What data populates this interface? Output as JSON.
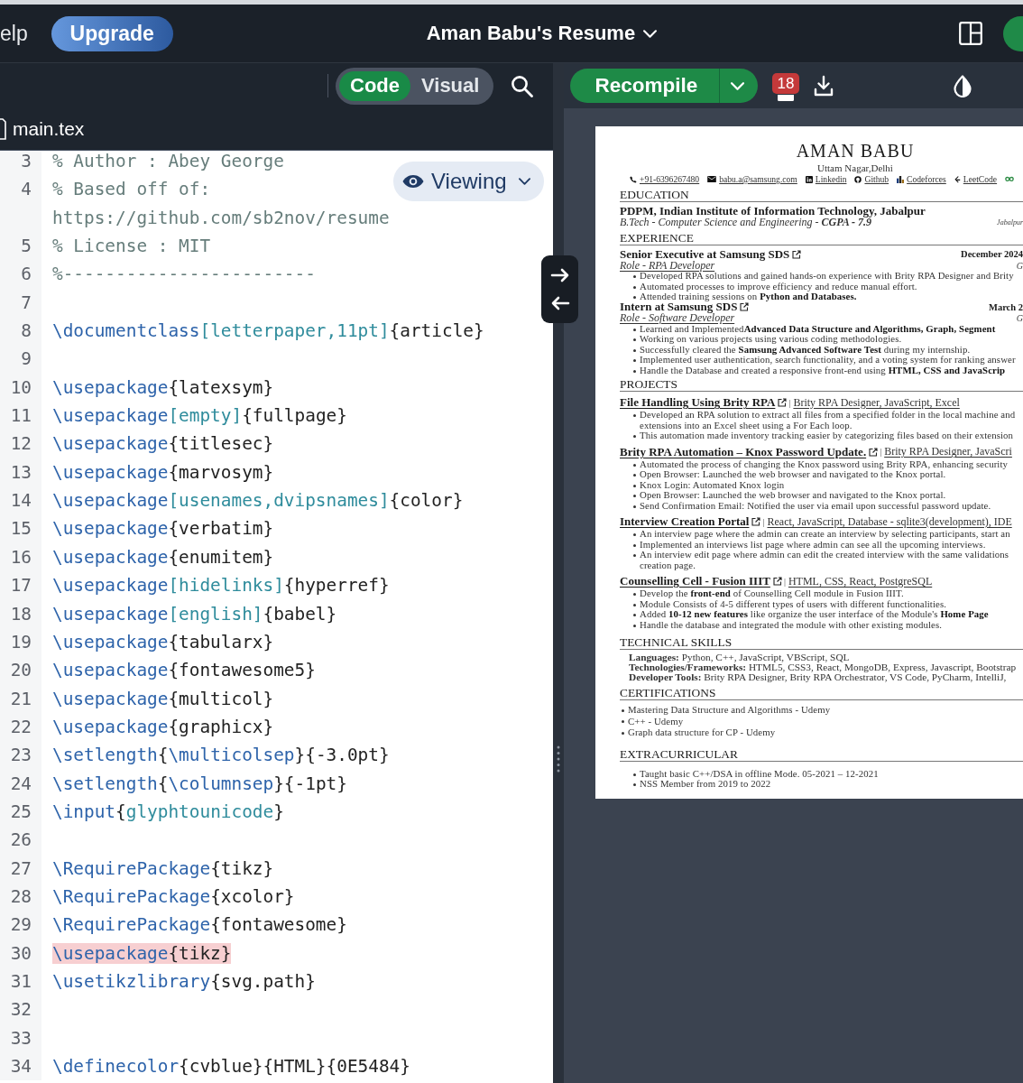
{
  "top_bar": {
    "help_menu": "elp",
    "upgrade_button": "Upgrade",
    "project_title": "Aman Babu's Resume"
  },
  "editor_toolbar": {
    "modes": [
      {
        "label": "Code",
        "selected": true
      },
      {
        "label": "Visual",
        "selected": false
      }
    ]
  },
  "file_tab": {
    "name": "main.tex"
  },
  "editor": {
    "view_mode": "Viewing",
    "lines": [
      {
        "number": "3",
        "highlighted": false,
        "tokens": [
          {
            "kind": "comment",
            "text": "% Author : Abey George"
          }
        ]
      },
      {
        "number": "4",
        "highlighted": false,
        "tokens": [
          {
            "kind": "comment",
            "text": "% Based off of: https://github.com/sb2nov/resume"
          }
        ]
      },
      {
        "number": "5",
        "highlighted": false,
        "tokens": [
          {
            "kind": "comment",
            "text": "% License : MIT"
          }
        ]
      },
      {
        "number": "6",
        "highlighted": false,
        "tokens": [
          {
            "kind": "comment",
            "text": "%------------------------"
          }
        ]
      },
      {
        "number": "7",
        "highlighted": false
      },
      {
        "number": "8",
        "highlighted": false,
        "tokens": [
          {
            "kind": "command",
            "text": "\\documentclass"
          },
          {
            "kind": "option",
            "text": "[letterpaper,11pt]"
          },
          {
            "kind": "text",
            "text": "{article}"
          }
        ]
      },
      {
        "number": "9",
        "highlighted": false
      },
      {
        "number": "10",
        "highlighted": false,
        "tokens": [
          {
            "kind": "command",
            "text": "\\usepackage"
          },
          {
            "kind": "text",
            "text": "{latexsym}"
          }
        ]
      },
      {
        "number": "11",
        "highlighted": false,
        "tokens": [
          {
            "kind": "command",
            "text": "\\usepackage"
          },
          {
            "kind": "option",
            "text": "[empty]"
          },
          {
            "kind": "text",
            "text": "{fullpage}"
          }
        ]
      },
      {
        "number": "12",
        "highlighted": false,
        "tokens": [
          {
            "kind": "command",
            "text": "\\usepackage"
          },
          {
            "kind": "text",
            "text": "{titlesec}"
          }
        ]
      },
      {
        "number": "13",
        "highlighted": false,
        "tokens": [
          {
            "kind": "command",
            "text": "\\usepackage"
          },
          {
            "kind": "text",
            "text": "{marvosym}"
          }
        ]
      },
      {
        "number": "14",
        "highlighted": false,
        "tokens": [
          {
            "kind": "command",
            "text": "\\usepackage"
          },
          {
            "kind": "option",
            "text": "[usenames,dvipsnames]"
          },
          {
            "kind": "text",
            "text": "{color}"
          }
        ]
      },
      {
        "number": "15",
        "highlighted": false,
        "tokens": [
          {
            "kind": "command",
            "text": "\\usepackage"
          },
          {
            "kind": "text",
            "text": "{verbatim}"
          }
        ]
      },
      {
        "number": "16",
        "highlighted": false,
        "tokens": [
          {
            "kind": "command",
            "text": "\\usepackage"
          },
          {
            "kind": "text",
            "text": "{enumitem}"
          }
        ]
      },
      {
        "number": "17",
        "highlighted": false,
        "tokens": [
          {
            "kind": "command",
            "text": "\\usepackage"
          },
          {
            "kind": "option",
            "text": "[hidelinks]"
          },
          {
            "kind": "text",
            "text": "{hyperref}"
          }
        ]
      },
      {
        "number": "18",
        "highlighted": false,
        "tokens": [
          {
            "kind": "command",
            "text": "\\usepackage"
          },
          {
            "kind": "option",
            "text": "[english]"
          },
          {
            "kind": "text",
            "text": "{babel}"
          }
        ]
      },
      {
        "number": "19",
        "highlighted": false,
        "tokens": [
          {
            "kind": "command",
            "text": "\\usepackage"
          },
          {
            "kind": "text",
            "text": "{tabularx}"
          }
        ]
      },
      {
        "number": "20",
        "highlighted": false,
        "tokens": [
          {
            "kind": "command",
            "text": "\\usepackage"
          },
          {
            "kind": "text",
            "text": "{fontawesome5}"
          }
        ]
      },
      {
        "number": "21",
        "highlighted": false,
        "tokens": [
          {
            "kind": "command",
            "text": "\\usepackage"
          },
          {
            "kind": "text",
            "text": "{multicol}"
          }
        ]
      },
      {
        "number": "22",
        "highlighted": false,
        "tokens": [
          {
            "kind": "command",
            "text": "\\usepackage"
          },
          {
            "kind": "text",
            "text": "{graphicx}"
          }
        ]
      },
      {
        "number": "23",
        "highlighted": false,
        "tokens": [
          {
            "kind": "command",
            "text": "\\setlength"
          },
          {
            "kind": "text",
            "text": "{"
          },
          {
            "kind": "command",
            "text": "\\multicolsep"
          },
          {
            "kind": "text",
            "text": "}{-3.0pt}"
          }
        ]
      },
      {
        "number": "24",
        "highlighted": false,
        "tokens": [
          {
            "kind": "command",
            "text": "\\setlength"
          },
          {
            "kind": "text",
            "text": "{"
          },
          {
            "kind": "command",
            "text": "\\columnsep"
          },
          {
            "kind": "text",
            "text": "}{-1pt}"
          }
        ]
      },
      {
        "number": "25",
        "highlighted": false,
        "tokens": [
          {
            "kind": "command",
            "text": "\\input"
          },
          {
            "kind": "text",
            "text": "{"
          },
          {
            "kind": "option",
            "text": "glyphtounicode"
          },
          {
            "kind": "text",
            "text": "}"
          }
        ]
      },
      {
        "number": "26",
        "highlighted": false
      },
      {
        "number": "27",
        "highlighted": false,
        "tokens": [
          {
            "kind": "command",
            "text": "\\RequirePackage"
          },
          {
            "kind": "text",
            "text": "{tikz}"
          }
        ]
      },
      {
        "number": "28",
        "highlighted": false,
        "tokens": [
          {
            "kind": "command",
            "text": "\\RequirePackage"
          },
          {
            "kind": "text",
            "text": "{xcolor}"
          }
        ]
      },
      {
        "number": "29",
        "highlighted": false,
        "tokens": [
          {
            "kind": "command",
            "text": "\\RequirePackage"
          },
          {
            "kind": "text",
            "text": "{fontawesome}"
          }
        ]
      },
      {
        "number": "30",
        "highlighted": true,
        "tokens": [
          {
            "kind": "command",
            "text": "\\usepackage"
          },
          {
            "kind": "text",
            "text": "{tikz}"
          }
        ]
      },
      {
        "number": "31",
        "highlighted": false,
        "tokens": [
          {
            "kind": "command",
            "text": "\\usetikzlibrary"
          },
          {
            "kind": "text",
            "text": "{svg.path}"
          }
        ]
      },
      {
        "number": "32",
        "highlighted": false
      },
      {
        "number": "33",
        "highlighted": false
      },
      {
        "number": "34",
        "highlighted": false,
        "tokens": [
          {
            "kind": "command",
            "text": "\\definecolor"
          },
          {
            "kind": "text",
            "text": "{cvblue}{HTML}{0E5484}"
          }
        ]
      }
    ]
  },
  "pdf_toolbar": {
    "recompile_button": "Recompile",
    "log_count": "18"
  },
  "resume": {
    "name": "AMAN BABU",
    "location": "Uttam Nagar,Delhi",
    "contacts": [
      {
        "kind": "phone",
        "text": "+91-6396267480"
      },
      {
        "kind": "email",
        "text": "babu.a@samsung.com"
      },
      {
        "kind": "linkedin",
        "text": "Linkedin"
      },
      {
        "kind": "github",
        "text": "Github"
      },
      {
        "kind": "codeforces",
        "text": "Codeforces"
      },
      {
        "kind": "leetcode",
        "text": "LeetCode"
      },
      {
        "kind": "geeksforgeeks"
      }
    ],
    "sections": [
      {
        "kind": "education",
        "title": "EDUCATION",
        "entries": [
          {
            "title": "PDPM, Indian Institute of Information Technology, Jabalpur",
            "link": false,
            "subtitle": "B.Tech - Computer Science and Engineering - **CGPA - 7.9**",
            "location": "Jabalpur"
          }
        ]
      },
      {
        "kind": "experience",
        "title": "EXPERIENCE",
        "entries": [
          {
            "title": "Senior Executive at Samsung SDS",
            "link": true,
            "date": "December 2024",
            "subtitle": "Role - RPA Developer",
            "location": "G",
            "bullets": [
              "Developed RPA solutions and gained hands-on experience with Brity RPA Designer and Brity",
              "Automated processes to improve efficiency and reduce manual effort.",
              "Attended training sessions on **Python and Databases.**"
            ]
          },
          {
            "title": "Intern at Samsung SDS",
            "link": true,
            "date": "March 2",
            "subtitle": "Role - Software Developer",
            "location": "G",
            "bullets": [
              "Learned and Implemented**Advanced Data Structure and Algorithms, Graph, Segment**",
              "Working on various projects using various coding methodologies.",
              "Successfully cleared the **Samsung Advanced Software Test** during my internship.",
              "Implemented user authentication, search functionality, and a voting system for ranking answer",
              "Handle the Database and created a responsive front-end using **HTML, CSS and JavaScrip**"
            ]
          }
        ]
      },
      {
        "kind": "projects",
        "title": "PROJECTS",
        "entries": [
          {
            "title": "File Handling Using Brity RPA",
            "link": true,
            "separator": "|",
            "tech": "Brity RPA Designer, JavaScript, Excel",
            "bullets": [
              [
                "Developed an RPA solution to extract all files from a specified folder in the local machine and",
                "extensions into an Excel sheet using a For Each loop."
              ],
              "This automation made inventory tracking easier by categorizing files based on their extension"
            ]
          },
          {
            "title": "Brity RPA Automation – Knox Password Update.",
            "link": true,
            "separator": "|",
            "tech": "Brity RPA Designer, JavaScri",
            "bullets": [
              "Automated the process of changing the Knox password using Brity RPA, enhancing security",
              "Open Browser: Launched the web browser and navigated to the Knox portal.",
              "Knox Login: Automated Knox login",
              "Open Browser: Launched the web browser and navigated to the Knox portal.",
              "Send Confirmation Email: Notified the user via email upon successful password update."
            ]
          },
          {
            "title": "Interview Creation Portal",
            "link": true,
            "separator": "|",
            "tech": "React, JavaScript, Database - sqlite3(development), IDE",
            "bullets": [
              "An interview page where the admin can create an interview by selecting participants, start an",
              "Implemented an interviews list page where admin can see all the upcoming interviews.",
              [
                "An interview edit page where admin can edit the created interview with the same validations",
                "creation page."
              ]
            ]
          },
          {
            "title": "Counselling Cell - Fusion IIIT",
            "link": true,
            "separator": "|",
            "tech": "HTML, CSS, React, PostgreSQL",
            "bullets": [
              "Develop the **front-end** of Counselling Cell module in Fusion IIIT.",
              "Module Consists of 4-5 different types of users with different functionalities.",
              "Added **10-12 new features** like organize the user interface of the Module's **Home Page**",
              "Handle the database and integrated the module with other existing modules."
            ]
          }
        ]
      },
      {
        "kind": "skills",
        "title": "TECHNICAL SKILLS",
        "rows": [
          "**Languages:** Python, C++, JavaScript, VBScript, SQL",
          "**Technologies/Frameworks:** HTML5, CSS3, React, MongoDB, Express, Javascript, Bootstrap",
          "**Developer Tools:** Brity RPA Designer, Brity RPA Orchestrator, VS Code, PyCharm, IntelliJ,"
        ]
      },
      {
        "kind": "flush_list",
        "title": "CERTIFICATIONS",
        "bullets": [
          "Mastering Data Structure and Algorithms - Udemy",
          "C++ - Udemy",
          "Graph data structure for CP - Udemy"
        ]
      },
      {
        "kind": "list",
        "title": "EXTRACURRICULAR",
        "bullets": [
          "Taught basic C++/DSA in offline Mode. 05-2021 – 12-2021",
          "NSS Member from 2019 to 2022"
        ]
      }
    ]
  }
}
